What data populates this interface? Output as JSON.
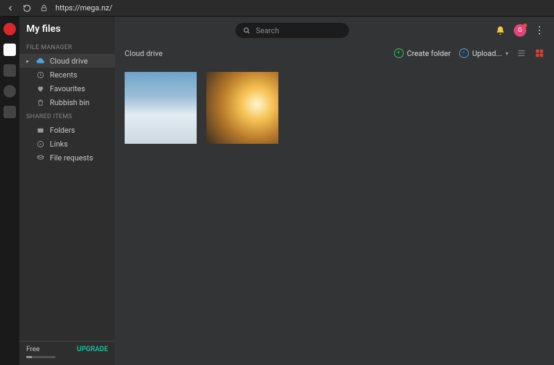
{
  "browser": {
    "url": "https://mega.nz/"
  },
  "header": {
    "title": "My files"
  },
  "sidebar": {
    "section1_label": "FILE MANAGER",
    "items1": {
      "cloud": "Cloud drive",
      "recents": "Recents",
      "favourites": "Favourites",
      "rubbish": "Rubbish bin"
    },
    "section2_label": "SHARED ITEMS",
    "items2": {
      "folders": "Folders",
      "links": "Links",
      "filereq": "File requests"
    },
    "footer": {
      "plan": "Free",
      "upgrade": "UPGRADE"
    }
  },
  "search": {
    "placeholder": "Search"
  },
  "toolbar": {
    "breadcrumb": "Cloud drive",
    "create_folder": "Create folder",
    "upload": "Upload..."
  },
  "colors": {
    "accent_green": "#1fbf9c",
    "brand_red": "#d0453a"
  }
}
